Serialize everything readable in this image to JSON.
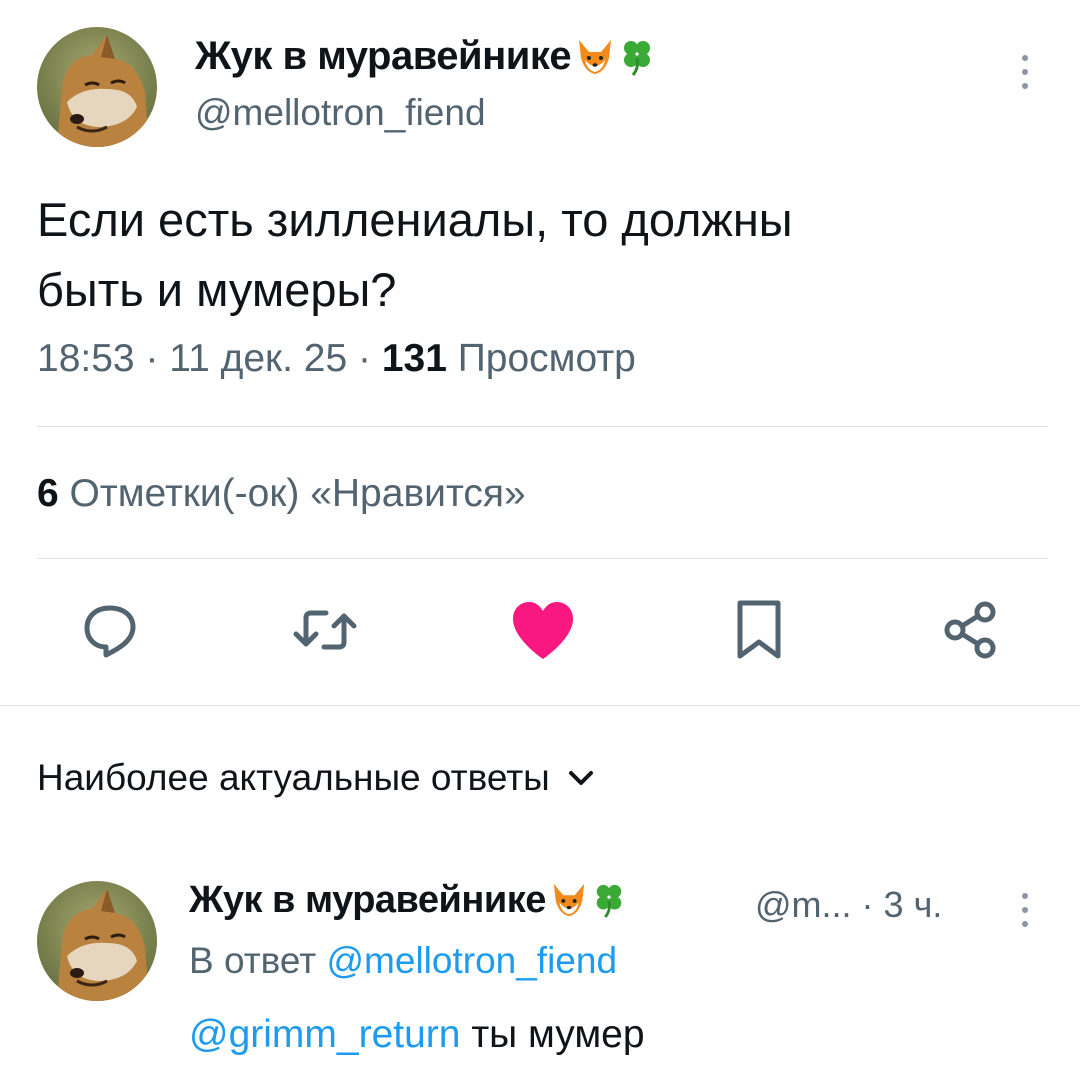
{
  "tweet": {
    "author_name": "Жук в муравейнике",
    "author_emojis": [
      "fox-emoji",
      "clover-emoji"
    ],
    "author_handle": "@mellotron_fiend",
    "text_line_1": "Если есть зиллениалы, то должны",
    "text_line_2": "быть и мумеры?",
    "time": "18:53",
    "sep1": " · ",
    "date": "11 дек. 25",
    "sep2": " · ",
    "views_count": "131",
    "views_label": " Просмотр"
  },
  "likes": {
    "count": "6",
    "label": " Отметки(-ок) «Нравится»"
  },
  "actions": {
    "icons": [
      "reply-icon",
      "retweet-icon",
      "like-icon",
      "bookmark-icon",
      "share-icon"
    ],
    "like_color": "#f91880",
    "icon_color": "#536471"
  },
  "replies_section": {
    "title": "Наиболее актуальные ответы"
  },
  "reply": {
    "author_name": "Жук в муравейнике",
    "handle_truncated": "@m...",
    "sep": " · ",
    "time_ago": "3 ч.",
    "reply_prefix": "В ответ ",
    "reply_to": "@mellotron_fiend",
    "mention": "@grimm_return",
    "text": " ты мумер"
  },
  "colors": {
    "text": "#0f1419",
    "secondary": "#536471",
    "link": "#1d9bf0",
    "divider": "#dfe3e7"
  }
}
